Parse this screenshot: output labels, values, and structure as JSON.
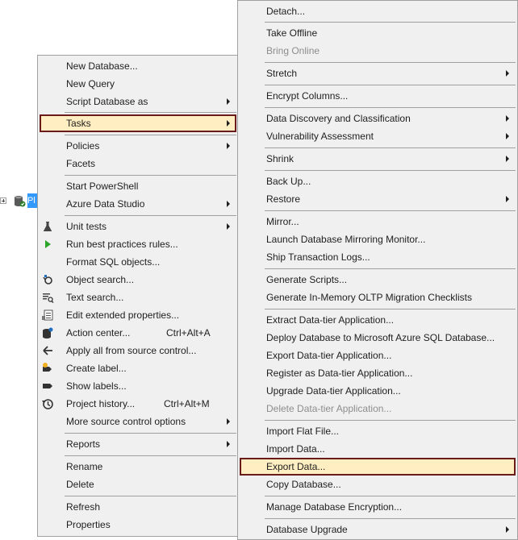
{
  "tree": {
    "node_label": "Pl"
  },
  "left_menu": {
    "items": [
      {
        "label": "New Database..."
      },
      {
        "label": "New Query"
      },
      {
        "label": "Script Database as"
      },
      {
        "label": "Tasks"
      },
      {
        "label": "Policies"
      },
      {
        "label": "Facets"
      },
      {
        "label": "Start PowerShell"
      },
      {
        "label": "Azure Data Studio"
      },
      {
        "label": "Unit tests"
      },
      {
        "label": "Run best practices rules..."
      },
      {
        "label": "Format SQL objects..."
      },
      {
        "label": "Object search..."
      },
      {
        "label": "Text search..."
      },
      {
        "label": "Edit extended properties..."
      },
      {
        "label": "Action center...",
        "shortcut": "Ctrl+Alt+A"
      },
      {
        "label": "Apply all from source control..."
      },
      {
        "label": "Create label..."
      },
      {
        "label": "Show labels..."
      },
      {
        "label": "Project history...",
        "shortcut": "Ctrl+Alt+M"
      },
      {
        "label": "More source control options"
      },
      {
        "label": "Reports"
      },
      {
        "label": "Rename"
      },
      {
        "label": "Delete"
      },
      {
        "label": "Refresh"
      },
      {
        "label": "Properties"
      }
    ]
  },
  "right_menu": {
    "items": [
      {
        "label": "Detach..."
      },
      {
        "label": "Take Offline"
      },
      {
        "label": "Bring Online"
      },
      {
        "label": "Stretch"
      },
      {
        "label": "Encrypt Columns..."
      },
      {
        "label": "Data Discovery and Classification"
      },
      {
        "label": "Vulnerability Assessment"
      },
      {
        "label": "Shrink"
      },
      {
        "label": "Back Up..."
      },
      {
        "label": "Restore"
      },
      {
        "label": "Mirror..."
      },
      {
        "label": "Launch Database Mirroring Monitor..."
      },
      {
        "label": "Ship Transaction Logs..."
      },
      {
        "label": "Generate Scripts..."
      },
      {
        "label": "Generate In-Memory OLTP Migration Checklists"
      },
      {
        "label": "Extract Data-tier Application..."
      },
      {
        "label": "Deploy Database to Microsoft Azure SQL Database..."
      },
      {
        "label": "Export Data-tier Application..."
      },
      {
        "label": "Register as Data-tier Application..."
      },
      {
        "label": "Upgrade Data-tier Application..."
      },
      {
        "label": "Delete Data-tier Application..."
      },
      {
        "label": "Import Flat File..."
      },
      {
        "label": "Import Data..."
      },
      {
        "label": "Export Data..."
      },
      {
        "label": "Copy Database..."
      },
      {
        "label": "Manage Database Encryption..."
      },
      {
        "label": "Database Upgrade"
      }
    ]
  },
  "colors": {
    "highlight_bg": "#ffeec1",
    "highlight_border": "#6b1a1a",
    "disabled_text": "#8d8d8d",
    "tree_selection": "#3399ff"
  }
}
